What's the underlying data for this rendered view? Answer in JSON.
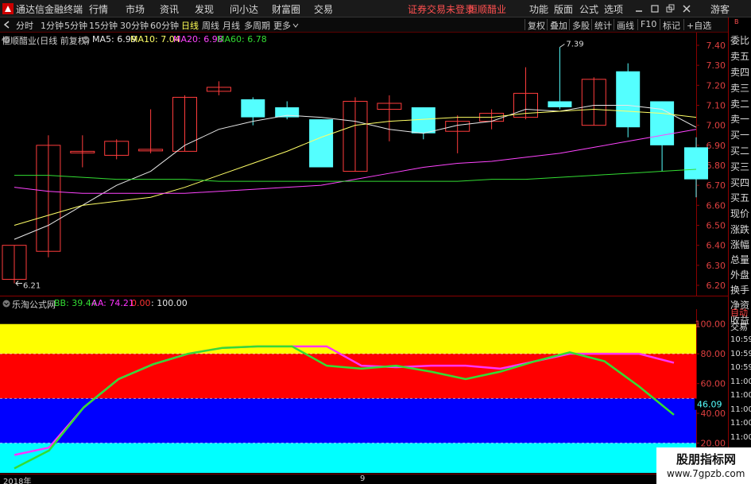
{
  "app": {
    "title": "通达信金融终端",
    "menu": [
      "行情",
      "市场",
      "资讯",
      "发现",
      "问小达",
      "财富圈",
      "交易"
    ],
    "warning": "证券交易未登录",
    "stock_name": "恒顺醋业",
    "right_menu": [
      "功能",
      "版面",
      "公式",
      "选项"
    ],
    "user": "游客"
  },
  "toolbar": {
    "periods": [
      "分时",
      "1分钟",
      "5分钟",
      "15分钟",
      "30分钟",
      "60分钟",
      "日线",
      "周线",
      "月线",
      "多周期",
      "更多"
    ],
    "active_period": "日线",
    "right_buttons": [
      "复权",
      "叠加",
      "多股",
      "统计",
      "画线",
      "F10",
      "标记",
      "+自选"
    ]
  },
  "main_info": {
    "title": "恒顺醋业(日线 前复权)",
    "ma": [
      {
        "label": "MA5: 6.99",
        "color": "#e8e8e8"
      },
      {
        "label": "MA10: 7.04",
        "color": "#ffff66"
      },
      {
        "label": "MA20: 6.98",
        "color": "#ff44ff"
      },
      {
        "label": "MA60: 6.78",
        "color": "#33dd33"
      }
    ]
  },
  "price_axis": {
    "min": 6.2,
    "max": 7.4,
    "ticks": [
      "7.40",
      "7.30",
      "7.20",
      "7.10",
      "7.00",
      "6.90",
      "6.80",
      "6.70",
      "6.60",
      "6.50",
      "6.40",
      "6.30",
      "6.20"
    ]
  },
  "annotations": {
    "low": "6.21",
    "high": "7.39"
  },
  "chart_data": [
    {
      "type": "candlestick",
      "title": "恒顺醋业(日线 前复权)",
      "ylim": [
        6.2,
        7.4
      ],
      "candles": [
        {
          "o": 6.23,
          "h": 6.4,
          "l": 6.21,
          "c": 6.4
        },
        {
          "o": 6.37,
          "h": 6.95,
          "l": 6.34,
          "c": 6.9
        },
        {
          "o": 6.87,
          "h": 6.95,
          "l": 6.79,
          "c": 6.87
        },
        {
          "o": 6.85,
          "h": 6.93,
          "l": 6.83,
          "c": 6.92
        },
        {
          "o": 6.88,
          "h": 7.08,
          "l": 6.86,
          "c": 6.88
        },
        {
          "o": 6.87,
          "h": 7.15,
          "l": 6.87,
          "c": 7.14
        },
        {
          "o": 7.17,
          "h": 7.22,
          "l": 7.15,
          "c": 7.19
        },
        {
          "o": 7.13,
          "h": 7.14,
          "l": 7.0,
          "c": 7.04
        },
        {
          "o": 7.09,
          "h": 7.12,
          "l": 7.03,
          "c": 7.04
        },
        {
          "o": 7.03,
          "h": 7.03,
          "l": 6.79,
          "c": 6.79
        },
        {
          "o": 6.77,
          "h": 7.14,
          "l": 6.77,
          "c": 7.12
        },
        {
          "o": 7.08,
          "h": 7.15,
          "l": 6.92,
          "c": 7.11
        },
        {
          "o": 7.09,
          "h": 7.09,
          "l": 6.93,
          "c": 6.96
        },
        {
          "o": 6.97,
          "h": 7.05,
          "l": 6.86,
          "c": 7.02
        },
        {
          "o": 7.02,
          "h": 7.08,
          "l": 6.98,
          "c": 7.06
        },
        {
          "o": 7.04,
          "h": 7.29,
          "l": 7.03,
          "c": 7.16
        },
        {
          "o": 7.12,
          "h": 7.39,
          "l": 7.08,
          "c": 7.09
        },
        {
          "o": 7.0,
          "h": 7.24,
          "l": 7.0,
          "c": 7.23
        },
        {
          "o": 7.27,
          "h": 7.31,
          "l": 6.94,
          "c": 6.99
        },
        {
          "o": 7.12,
          "h": 7.12,
          "l": 6.77,
          "c": 6.9
        },
        {
          "o": 6.89,
          "h": 6.94,
          "l": 6.64,
          "c": 6.73
        }
      ],
      "series": [
        {
          "name": "MA5",
          "color": "#e8e8e8",
          "values": [
            6.43,
            6.5,
            6.6,
            6.7,
            6.77,
            6.9,
            6.98,
            7.02,
            7.05,
            7.04,
            7.02,
            6.98,
            6.96,
            7.0,
            7.02,
            7.08,
            7.07,
            7.1,
            7.1,
            7.08,
            6.99
          ]
        },
        {
          "name": "MA10",
          "color": "#ffff66",
          "values": [
            6.5,
            6.55,
            6.6,
            6.62,
            6.64,
            6.69,
            6.75,
            6.81,
            6.87,
            6.94,
            7.0,
            7.02,
            7.03,
            7.04,
            7.04,
            7.06,
            7.07,
            7.08,
            7.07,
            7.06,
            7.04
          ]
        },
        {
          "name": "MA20",
          "color": "#ff44ff",
          "values": [
            6.69,
            6.67,
            6.66,
            6.66,
            6.66,
            6.66,
            6.67,
            6.68,
            6.69,
            6.7,
            6.73,
            6.76,
            6.79,
            6.81,
            6.82,
            6.84,
            6.86,
            6.89,
            6.92,
            6.95,
            6.98
          ]
        },
        {
          "name": "MA60",
          "color": "#33dd33",
          "values": [
            6.75,
            6.75,
            6.74,
            6.73,
            6.73,
            6.73,
            6.72,
            6.72,
            6.72,
            6.72,
            6.72,
            6.72,
            6.72,
            6.72,
            6.73,
            6.73,
            6.74,
            6.75,
            6.76,
            6.77,
            6.78
          ]
        }
      ]
    },
    {
      "type": "line",
      "title": "乐淘公式网",
      "ylim": [
        0,
        110
      ],
      "bands": [
        {
          "from": 80,
          "to": 100,
          "color": "#ffff00"
        },
        {
          "from": 50,
          "to": 80,
          "color": "#ff0000"
        },
        {
          "from": 20,
          "to": 50,
          "color": "#0000ff"
        },
        {
          "from": 0,
          "to": 20,
          "color": "#00ffff"
        }
      ],
      "series": [
        {
          "name": "BB",
          "color": "#33dd33",
          "values": [
            3,
            15,
            44,
            63,
            73,
            80,
            84,
            85,
            85,
            72,
            70,
            72,
            68,
            63,
            68,
            75,
            81,
            75,
            58,
            39
          ]
        },
        {
          "name": "AA",
          "color": "#ff33ff",
          "values": [
            12,
            17,
            44,
            63,
            73,
            80,
            84,
            85,
            85,
            85,
            72,
            71,
            72,
            72,
            70,
            75,
            80,
            80,
            80,
            74
          ]
        }
      ]
    }
  ],
  "indicator_info": {
    "title": "乐淘公式网",
    "bb": "BB: 39.44",
    "aa": "AA: 74.21",
    "v1": "0.00",
    "v2": ": 100.00"
  },
  "indicator_axis": {
    "ticks": [
      "100.00",
      "80.00",
      "60.00",
      "40.00",
      "20.00"
    ],
    "cursor": "46.09"
  },
  "date_axis": {
    "left": "2018年",
    "mid": "9"
  },
  "right_panel": {
    "rows": [
      "委比",
      "卖五",
      "卖四",
      "卖三",
      "卖二",
      "卖一",
      "买一",
      "买二",
      "买三",
      "买四",
      "买五",
      "现价",
      "涨跌",
      "涨幅",
      "总量",
      "外盘",
      "换手",
      "净资",
      "收益"
    ],
    "header": "自动",
    "trade_header": "交易",
    "times": [
      "10:59",
      "10:59",
      "10:59",
      "11:00",
      "11:00",
      "11:00",
      "11:00",
      "11:00",
      "11:00",
      "11:00"
    ]
  },
  "watermark": {
    "cn": "股朋指标网",
    "url": "www.7gpzb.com"
  }
}
